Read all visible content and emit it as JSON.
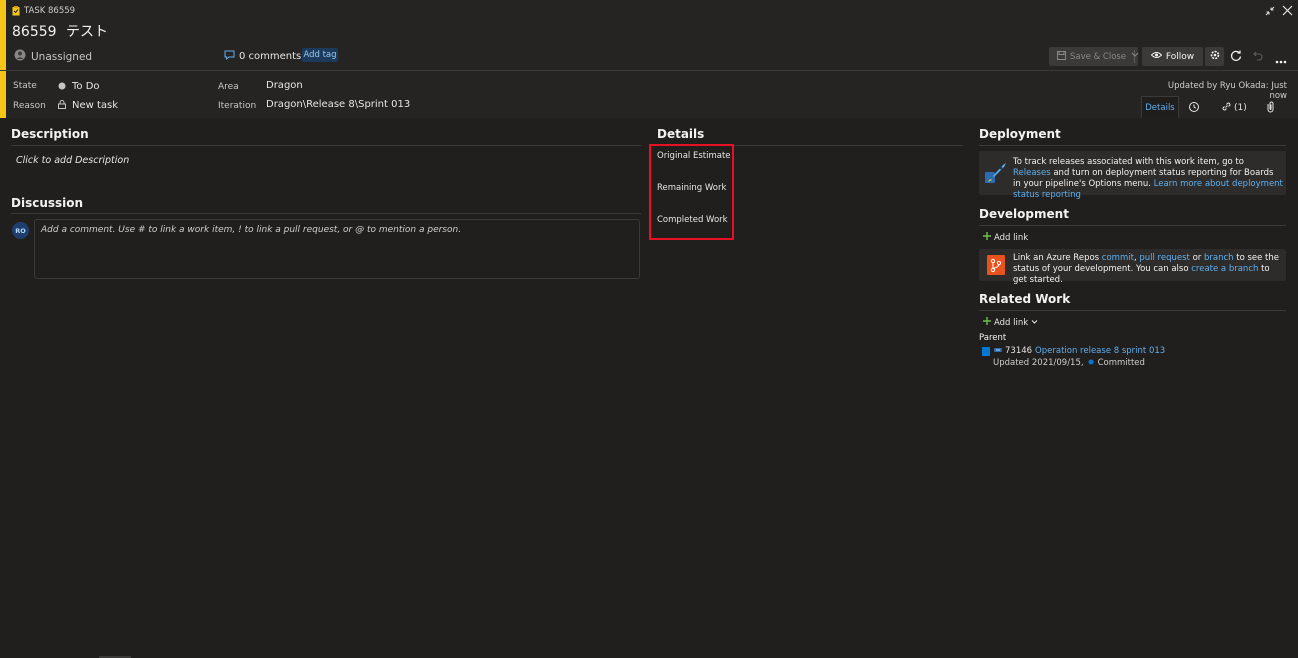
{
  "header": {
    "type_badge": "TASK 86559",
    "id": "86559",
    "title": "テスト",
    "assigned": "Unassigned",
    "comments": "0 comments",
    "add_tag": "Add tag",
    "save_close": "Save & Close",
    "follow": "Follow"
  },
  "fields": {
    "state_label": "State",
    "state_value": "To Do",
    "reason_label": "Reason",
    "reason_value": "New task",
    "area_label": "Area",
    "area_value": "Dragon",
    "iteration_label": "Iteration",
    "iteration_value": "Dragon\\Release 8\\Sprint 013",
    "updated": "Updated by Ryu Okada: Just now"
  },
  "tabs": {
    "details": "Details",
    "links": "(1)"
  },
  "description": {
    "title": "Description",
    "placeholder": "Click to add Description"
  },
  "discussion": {
    "title": "Discussion",
    "avatar": "RO",
    "placeholder": "Add a comment. Use # to link a work item, ! to link a pull request, or @ to mention a person."
  },
  "details": {
    "title": "Details",
    "original_estimate": "Original Estimate",
    "remaining_work": "Remaining Work",
    "completed_work": "Completed Work"
  },
  "deployment": {
    "title": "Deployment",
    "text1": "To track releases associated with this work item, go to ",
    "releases_link": "Releases",
    "text2": " and turn on deployment status reporting for Boards in your pipeline's Options menu. ",
    "learn_link": "Learn more about deployment status reporting"
  },
  "development": {
    "title": "Development",
    "add_link": "Add link",
    "text1": "Link an Azure Repos ",
    "commit_link": "commit",
    "sep1": ", ",
    "pr_link": "pull request",
    "text2": " or ",
    "branch_link": "branch",
    "text3": " to see the status of your development. You can also ",
    "create_branch_link": "create a branch",
    "text4": " to get started."
  },
  "related": {
    "title": "Related Work",
    "add_link": "Add link",
    "parent_label": "Parent",
    "parent_id": "73146",
    "parent_title": "Operation release 8 sprint 013",
    "updated": "Updated 2021/09/15,",
    "status": "Committed"
  },
  "colors": {
    "accent_yellow": "#f5c518",
    "link": "#5eb0ef",
    "highlight_red": "#e81123",
    "committed_blue": "#0078d4"
  }
}
